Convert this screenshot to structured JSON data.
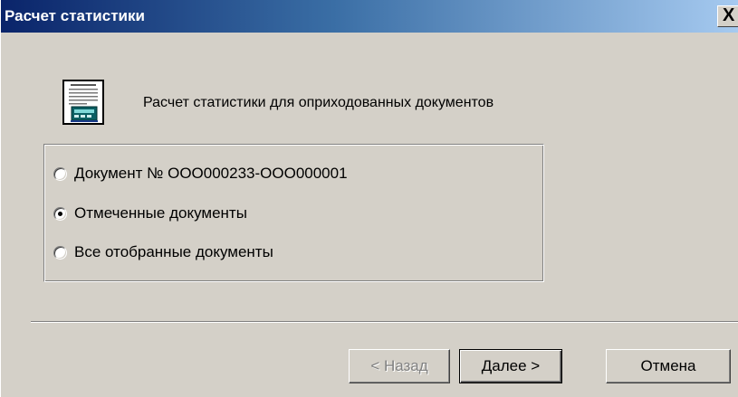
{
  "window": {
    "title": "Расчет статистики",
    "close_glyph": "X"
  },
  "header": {
    "icon": "document-calculator-icon",
    "description": "Расчет статистики для оприходованных документов"
  },
  "options": [
    {
      "label": "Документ № ООО000233-ООО000001",
      "checked": false
    },
    {
      "label": "Отмеченные документы",
      "checked": true
    },
    {
      "label": "Все отобранные документы",
      "checked": false
    }
  ],
  "buttons": {
    "back_label": "< Назад",
    "next_label": "Далее >",
    "cancel_label": "Отмена"
  },
  "colors": {
    "titlebar_start": "#0a246a",
    "titlebar_end": "#a6caf0",
    "face": "#d4d0c8"
  }
}
